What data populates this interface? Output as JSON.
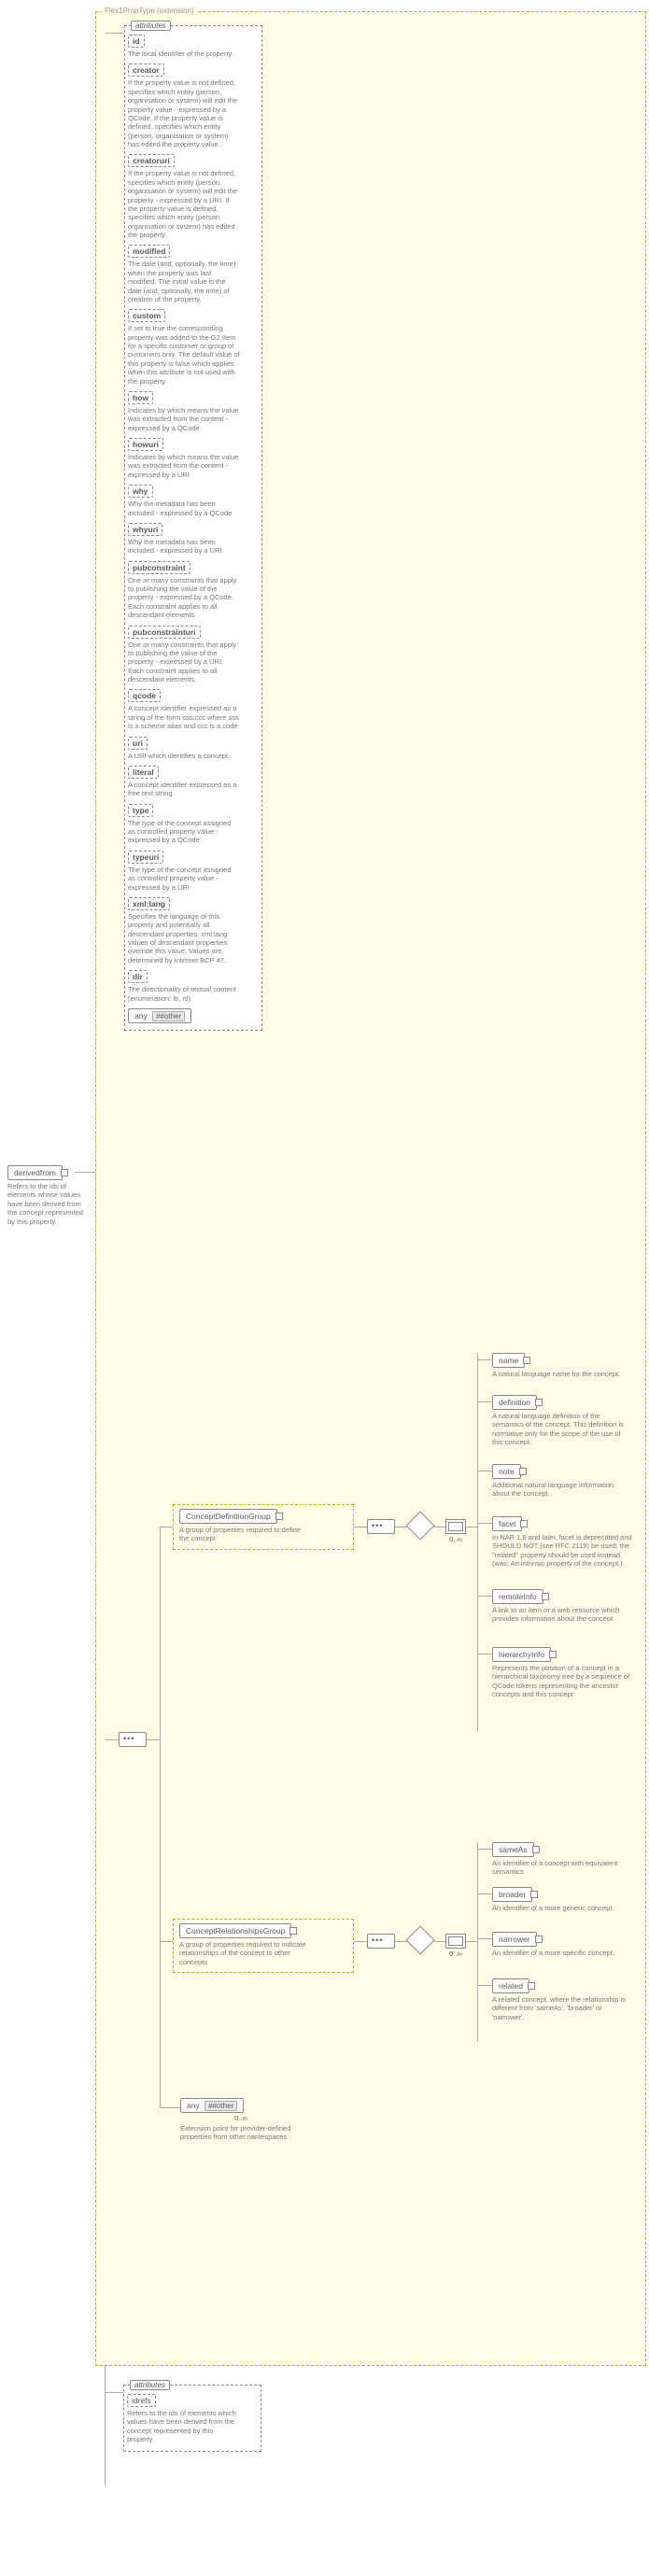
{
  "frame_label": "Flex1PropType (extension)",
  "root": {
    "element": "derivedfrom",
    "doc": "Refers to the ids of elements whose values have been derived from the concept represented by this property."
  },
  "attrs1_title": "attributes",
  "attrs1": [
    {
      "name": "id",
      "bold": true,
      "doc": "The local identifier of the property."
    },
    {
      "name": "creator",
      "bold": true,
      "doc": "If the property value is not defined, specifies which entity (person, organisation or system) will edit the property value - expressed by a QCode. If the property value is defined, specifies which entity (person, organisation or system) has edited the property value."
    },
    {
      "name": "creatoruri",
      "bold": true,
      "doc": "If the property value is not defined, specifies which entity (person, organisation or system) will edit the property - expressed by a URI. If the property value is defined, specifies which entity (person, organisation or system) has edited the property."
    },
    {
      "name": "modified",
      "bold": true,
      "doc": "The date (and, optionally, the time) when the property was last modified. The initial value is the date (and, optionally, the time) of creation of the property."
    },
    {
      "name": "custom",
      "bold": true,
      "doc": "If set to true the corresponding property was added to the G2 Item for a specific customer or group of customers only. The default value of this property is false which applies when this attribute is not used with the property."
    },
    {
      "name": "how",
      "bold": true,
      "doc": "Indicates by which means the value was extracted from the content - expressed by a QCode"
    },
    {
      "name": "howuri",
      "bold": true,
      "doc": "Indicates by which means the value was extracted from the content - expressed by a URI"
    },
    {
      "name": "why",
      "bold": true,
      "doc": "Why the metadata has been included - expressed by a QCode"
    },
    {
      "name": "whyuri",
      "bold": true,
      "doc": "Why the metadata has been included - expressed by a URI"
    },
    {
      "name": "pubconstraint",
      "bold": true,
      "doc": "One or many constraints that apply to publishing the value of the property - expressed by a QCode. Each constraint applies to all descendant elements."
    },
    {
      "name": "pubconstrainturi",
      "bold": true,
      "doc": "One or many constraints that apply to publishing the value of the property - expressed by a URI. Each constraint applies to all descendant elements."
    },
    {
      "name": "qcode",
      "bold": true,
      "doc": "A concept identifier expressed as a string of the form sss:ccc where sss is a scheme alias and ccc is a code"
    },
    {
      "name": "uri",
      "bold": true,
      "doc": "A URI which identifies a concept."
    },
    {
      "name": "literal",
      "bold": true,
      "doc": "A concept identifier expressed as a free text string."
    },
    {
      "name": "type",
      "bold": true,
      "doc": "The type of the concept assigned as controlled property value - expressed by a QCode"
    },
    {
      "name": "typeuri",
      "bold": true,
      "doc": "The type of the concept assigned as controlled property value - expressed by a URI"
    },
    {
      "name": "xml:lang",
      "bold": true,
      "doc": "Specifies the language of this property and potentially all descendant properties. xml:lang values of descendant properties override this value. Values are determined by Internet BCP 47."
    },
    {
      "name": "dir",
      "bold": true,
      "doc": "The directionality of textual content (enumeration: ltr, rtl)"
    }
  ],
  "attrs1_any": "##other",
  "concept_def_group": {
    "name": "ConceptDefinitionGroup",
    "doc": "A group of properties required to define the concept",
    "occur": "0..∞",
    "items": [
      {
        "el": "name",
        "doc": "A natural language name for the concept."
      },
      {
        "el": "definition",
        "doc": "A natural language definition of the semantics of the concept. This definition is normative only for the scope of the use of this concept."
      },
      {
        "el": "note",
        "doc": "Additional natural language information about the concept."
      },
      {
        "el": "facet",
        "doc": "In NAR 1.8 and later, facet is deprecated and SHOULD NOT (see RFC 2119) be used; the \"related\" property should be used instead. (was: An intrinsic property of the concept.)"
      },
      {
        "el": "remoteInfo",
        "doc": "A link to an item or a web resource which provides information about the concept"
      },
      {
        "el": "hierarchyInfo",
        "doc": "Represents the position of a concept in a hierarchical taxonomy tree by a sequence of QCode tokens representing the ancestor concepts and this concept"
      }
    ]
  },
  "concept_rel_group": {
    "name": "ConceptRelationshipsGroup",
    "doc": "A group of properties required to indicate relationships of the concept to other concepts",
    "occur": "0..∞",
    "items": [
      {
        "el": "sameAs",
        "doc": "An identifier of a concept with equivalent semantics"
      },
      {
        "el": "broader",
        "doc": "An identifier of a more generic concept."
      },
      {
        "el": "narrower",
        "doc": "An identifier of a more specific concept."
      },
      {
        "el": "related",
        "doc": "A related concept, where the relationship is different from 'sameAs', 'broader' or 'narrower'."
      }
    ]
  },
  "ext_any": {
    "ns": "##other",
    "occur": "0..∞",
    "doc": "Extension point for provider-defined properties from other namespaces"
  },
  "attrs2_title": "attributes",
  "attrs2": [
    {
      "name": "idrefs",
      "bold": false,
      "doc": "Refers to the ids of elements which values have been derived from the concept represented by this property"
    }
  ]
}
